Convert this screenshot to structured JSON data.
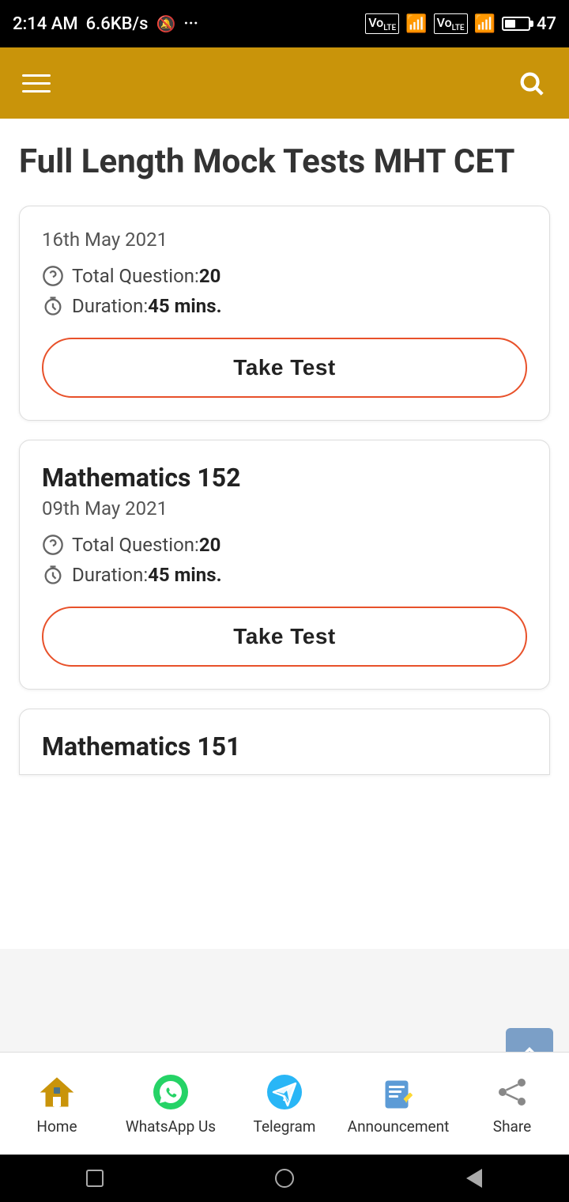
{
  "statusBar": {
    "time": "2:14 AM",
    "network": "6.6KB/s",
    "battery": "47"
  },
  "toolbar": {
    "menuLabel": "menu",
    "searchLabel": "search"
  },
  "page": {
    "title": "Full Length Mock Tests MHT CET"
  },
  "cards": [
    {
      "id": "card-1",
      "title": "",
      "date": "16th May 2021",
      "totalQuestion": "20",
      "duration": "45 mins.",
      "buttonLabel": "Take Test"
    },
    {
      "id": "card-2",
      "title": "Mathematics 152",
      "date": "09th May 2021",
      "totalQuestion": "20",
      "duration": "45 mins.",
      "buttonLabel": "Take Test"
    },
    {
      "id": "card-3",
      "title": "Mathematics 151",
      "date": "",
      "totalQuestion": "",
      "duration": "",
      "buttonLabel": ""
    }
  ],
  "labels": {
    "totalQuestionPrefix": "Total Question:",
    "durationPrefix": "Duration:"
  },
  "bottomNav": [
    {
      "id": "home",
      "label": "Home",
      "icon": "home-icon"
    },
    {
      "id": "whatsapp",
      "label": "WhatsApp Us",
      "icon": "whatsapp-icon"
    },
    {
      "id": "telegram",
      "label": "Telegram",
      "icon": "telegram-icon"
    },
    {
      "id": "announcement",
      "label": "Announcement",
      "icon": "announcement-icon"
    },
    {
      "id": "share",
      "label": "Share",
      "icon": "share-icon"
    }
  ]
}
